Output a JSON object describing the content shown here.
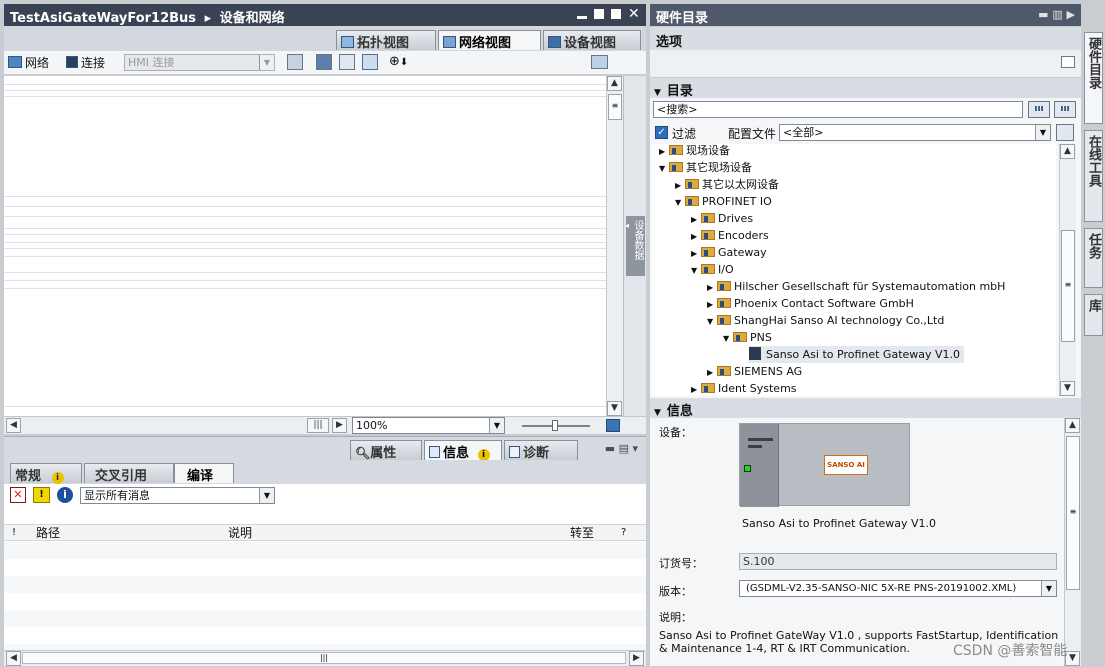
{
  "main_window": {
    "title_project": "TestAsiGateWayFor12Bus",
    "title_sep": "▸",
    "title_section": "设备和网络",
    "view_tabs": [
      {
        "label": "拓扑视图",
        "icon": "topology-icon"
      },
      {
        "label": "网络视图",
        "icon": "network-view-icon"
      },
      {
        "label": "设备视图",
        "icon": "device-view-icon"
      }
    ]
  },
  "toolbar": {
    "network_label": "网络",
    "connect_label": "连接",
    "connection_type": "HMI 连接"
  },
  "canvas": {
    "side_label": "设备数据",
    "zoom": "100%"
  },
  "inspector": {
    "tabs": [
      {
        "label": "属性"
      },
      {
        "label": "信息"
      },
      {
        "label": "诊断"
      }
    ],
    "subtabs": [
      {
        "label": "常规"
      },
      {
        "label": "交叉引用"
      },
      {
        "label": "编译"
      }
    ],
    "filter_value": "显示所有消息",
    "table_headers": {
      "bang": "!",
      "path": "路径",
      "desc": "说明",
      "goto": "转至",
      "q": "?"
    }
  },
  "catalog": {
    "title": "硬件目录",
    "options_label": "选项",
    "directory_label": "目录",
    "search_placeholder": "<搜索>",
    "filter_label": "过滤",
    "profile_label": "配置文件",
    "profile_value": "<全部>",
    "tree": [
      {
        "label": "现场设备",
        "level": 0,
        "expanded": false
      },
      {
        "label": "其它现场设备",
        "level": 0,
        "expanded": true
      },
      {
        "label": "其它以太网设备",
        "level": 1,
        "expanded": false
      },
      {
        "label": "PROFINET IO",
        "level": 1,
        "expanded": true
      },
      {
        "label": "Drives",
        "level": 2,
        "expanded": false
      },
      {
        "label": "Encoders",
        "level": 2,
        "expanded": false
      },
      {
        "label": "Gateway",
        "level": 2,
        "expanded": false
      },
      {
        "label": "I/O",
        "level": 2,
        "expanded": true
      },
      {
        "label": "Hilscher Gesellschaft für Systemautomation mbH",
        "level": 3,
        "expanded": false
      },
      {
        "label": "Phoenix Contact Software GmbH",
        "level": 3,
        "expanded": false
      },
      {
        "label": "ShangHai Sanso AI technology Co.,Ltd",
        "level": 3,
        "expanded": true
      },
      {
        "label": "PNS",
        "level": 4,
        "expanded": true
      },
      {
        "label": "Sanso Asi to Profinet Gateway V1.0",
        "level": 5,
        "leaf": true
      },
      {
        "label": "SIEMENS AG",
        "level": 3,
        "expanded": false
      },
      {
        "label": "Ident Systems",
        "level": 2,
        "expanded": false
      }
    ]
  },
  "info": {
    "title": "信息",
    "device_label": "设备：",
    "device_caption": "Sanso Asi to Profinet Gateway V1.0",
    "brand_logo_text": "SANSO AI",
    "order_label": "订货号：",
    "order_value": "S.100",
    "version_label": "版本：",
    "version_value": "(GSDML-V2.35-SANSO-NIC 5X-RE PNS-20191002.XML)",
    "desc_label": "说明：",
    "description": "Sanso Asi to Profinet GateWay V1.0 , supports FastStartup, Identification & Maintenance 1-4, RT & IRT Communication."
  },
  "side_tabs": [
    {
      "label": "硬件目录"
    },
    {
      "label": "在线工具"
    },
    {
      "label": "任务"
    },
    {
      "label": "库"
    }
  ],
  "watermark": "CSDN @善索智能",
  "colors": {
    "titlebar": "#3a4354",
    "panel_header": "#d8dde4",
    "folder": "#e0a93b"
  }
}
